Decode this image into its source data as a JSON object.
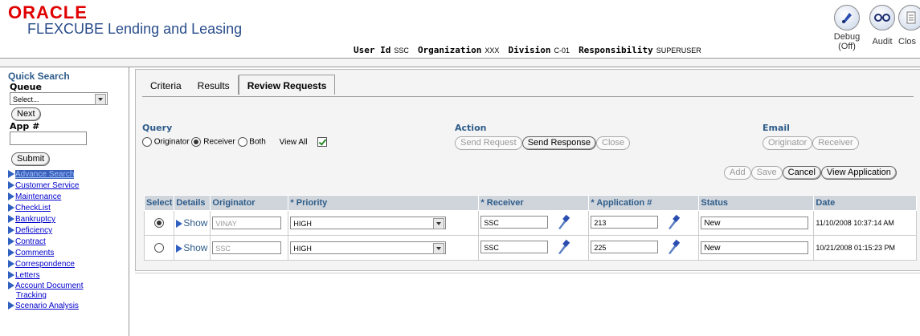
{
  "header": {
    "brand": "ORACLE",
    "product": "FLEXCUBE Lending and Leasing",
    "user_id_label": "User Id",
    "user_id": "SSC",
    "org_label": "Organization",
    "org": "XXX",
    "division_label": "Division",
    "division": "C-01",
    "resp_label": "Responsibility",
    "resp": "SUPERUSER",
    "debug_label": "Debug",
    "debug_state": "(Off)",
    "audit_label": "Audit",
    "close_label": "Clos"
  },
  "sidebar": {
    "quick_search": "Quick Search",
    "queue_label": "Queue",
    "queue_value": "Select...",
    "next_label": "Next",
    "app_label": "App #",
    "app_value": "",
    "submit_label": "Submit",
    "items": [
      {
        "label": "Advance Search"
      },
      {
        "label": "Customer Service"
      },
      {
        "label": "Maintenance"
      },
      {
        "label": "CheckList"
      },
      {
        "label": "Bankruptcy"
      },
      {
        "label": "Deficiency"
      },
      {
        "label": "Contract"
      },
      {
        "label": "Comments"
      },
      {
        "label": "Correspondence"
      },
      {
        "label": "Letters"
      },
      {
        "label": "Account Document"
      },
      {
        "label": "Tracking"
      },
      {
        "label": "Scenario Analysis"
      }
    ]
  },
  "tabs": [
    {
      "label": "Criteria"
    },
    {
      "label": "Results"
    },
    {
      "label": "Review Requests"
    }
  ],
  "query": {
    "title": "Query",
    "originator": "Originator",
    "receiver": "Receiver",
    "both": "Both",
    "view_all": "View All"
  },
  "action": {
    "title": "Action",
    "send_request": "Send Request",
    "send_response": "Send Response",
    "close": "Close"
  },
  "email": {
    "title": "Email",
    "originator": "Originator",
    "receiver": "Receiver"
  },
  "buttons": {
    "add": "Add",
    "save": "Save",
    "cancel": "Cancel",
    "view_application": "View Application"
  },
  "table": {
    "headers": [
      "Select",
      "Details",
      "Originator",
      "Priority",
      "Receiver",
      "Application #",
      "Status",
      "Date"
    ],
    "required_mark": "*",
    "show_label": "Show",
    "rows": [
      {
        "selected": true,
        "originator": "VINAY",
        "priority": "HIGH",
        "receiver": "SSC",
        "application": "213",
        "status": "New",
        "date": "11/10/2008 10:37:14 AM"
      },
      {
        "selected": false,
        "originator": "SSC",
        "priority": "HIGH",
        "receiver": "SSC",
        "application": "225",
        "status": "New",
        "date": "10/21/2008 01:15:23 PM"
      }
    ]
  }
}
